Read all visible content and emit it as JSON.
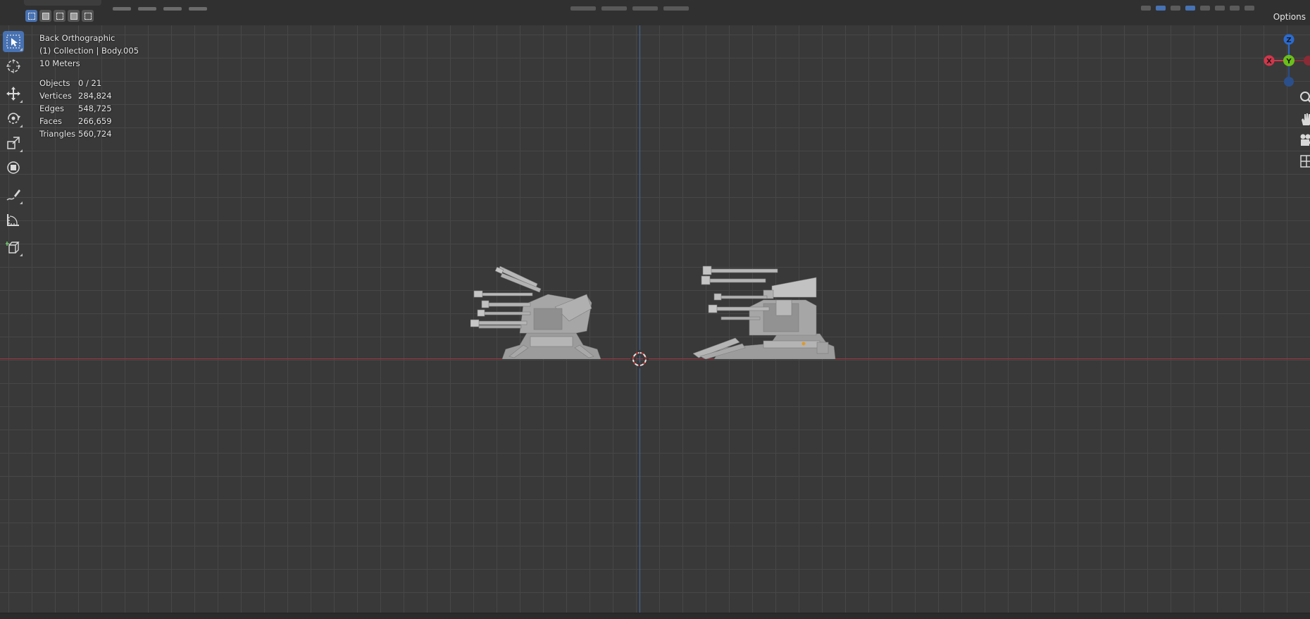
{
  "viewport": {
    "view_name": "Back Orthographic",
    "collection_line": "(1) Collection | Body.005",
    "scale_line": "10 Meters",
    "stats": [
      {
        "label": "Objects",
        "value": "0 / 21"
      },
      {
        "label": "Vertices",
        "value": "284,824"
      },
      {
        "label": "Edges",
        "value": "548,725"
      },
      {
        "label": "Faces",
        "value": "266,659"
      },
      {
        "label": "Triangles",
        "value": "560,724"
      }
    ]
  },
  "header": {
    "options_label": "Options"
  },
  "gizmo": {
    "axes": [
      {
        "label": "Z",
        "color": "#2b6bd1"
      },
      {
        "label": "Y",
        "color": "#6bbf1a"
      },
      {
        "label": "X",
        "color": "#d2364a"
      }
    ]
  },
  "toolbar": {
    "tools": [
      "select-box",
      "cursor",
      "move",
      "rotate",
      "scale",
      "transform",
      "annotate",
      "measure",
      "add-cube"
    ]
  },
  "colors": {
    "accent": "#4772b3",
    "axis_x": "#a5343e",
    "axis_z": "#3e6aa6",
    "background": "#393939"
  }
}
